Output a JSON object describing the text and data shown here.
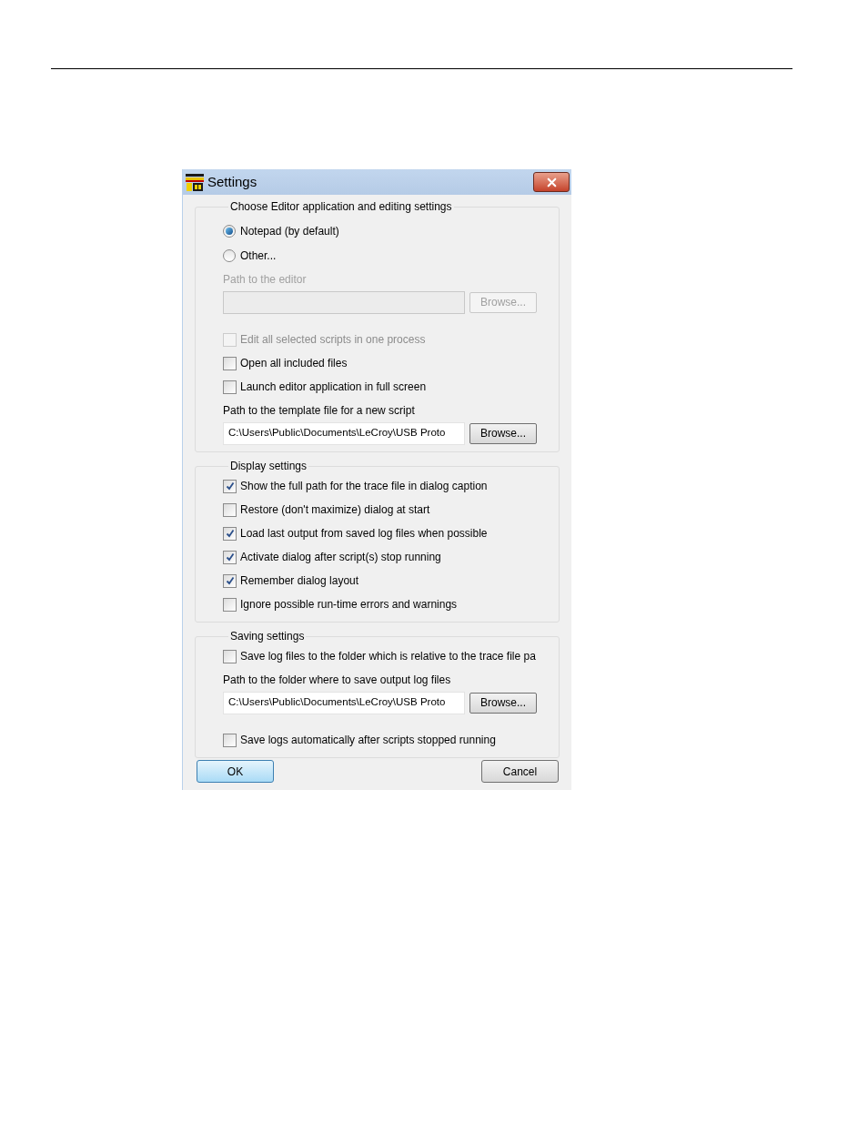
{
  "window": {
    "title": "Settings"
  },
  "sections": [
    {
      "title": "Choose Editor application and editing settings",
      "items": [
        {
          "kind": "radio",
          "label": "Notepad (by default)",
          "selected": true
        },
        {
          "kind": "radio",
          "label": "Other...",
          "selected": false
        },
        {
          "kind": "caption",
          "text": "Path to the editor",
          "disabled": true
        },
        {
          "kind": "field",
          "button": "Browse...",
          "disabled": true
        },
        {
          "kind": "checkbox",
          "label": "Edit all selected scripts in one process",
          "checked": false,
          "disabled": true
        },
        {
          "kind": "checkbox",
          "label": "Open all included files",
          "checked": false,
          "disabled": false
        },
        {
          "kind": "checkbox",
          "label": "Launch editor application in full screen",
          "checked": false,
          "disabled": false
        },
        {
          "kind": "caption",
          "text": "Path to the template file for a new script",
          "disabled": false
        },
        {
          "kind": "field",
          "value": "C:\\Users\\Public\\Documents\\LeCroy\\USB Proto",
          "button": "Browse...",
          "disabled": false
        }
      ]
    },
    {
      "title": "Display settings",
      "items": [
        {
          "kind": "checkbox",
          "label": "Show the full path for the trace file in dialog caption",
          "checked": true,
          "disabled": false
        },
        {
          "kind": "checkbox",
          "label": "Restore (don't maximize) dialog at start",
          "checked": false,
          "disabled": false
        },
        {
          "kind": "checkbox",
          "label": "Load last output from saved log files when possible",
          "checked": true,
          "disabled": false
        },
        {
          "kind": "checkbox",
          "label": "Activate dialog after script(s) stop running",
          "checked": true,
          "disabled": false
        },
        {
          "kind": "checkbox",
          "label": "Remember dialog layout",
          "checked": true,
          "disabled": false
        },
        {
          "kind": "checkbox",
          "label": "Ignore possible run-time errors and warnings",
          "checked": false,
          "disabled": false
        }
      ]
    },
    {
      "title": "Saving settings",
      "items": [
        {
          "kind": "checkbox",
          "label": "Save log files to the folder which is relative to the trace file pa",
          "checked": false,
          "disabled": false
        },
        {
          "kind": "caption",
          "text": "Path to the folder where to save output log files",
          "disabled": false
        },
        {
          "kind": "field",
          "value": "C:\\Users\\Public\\Documents\\LeCroy\\USB Proto",
          "button": "Browse...",
          "disabled": false
        },
        {
          "kind": "checkbox",
          "label": "Save logs automatically after scripts stopped running",
          "checked": false,
          "disabled": false
        }
      ]
    }
  ],
  "buttons": [
    {
      "label": "OK",
      "default": true
    },
    {
      "label": "Cancel",
      "default": false
    }
  ]
}
